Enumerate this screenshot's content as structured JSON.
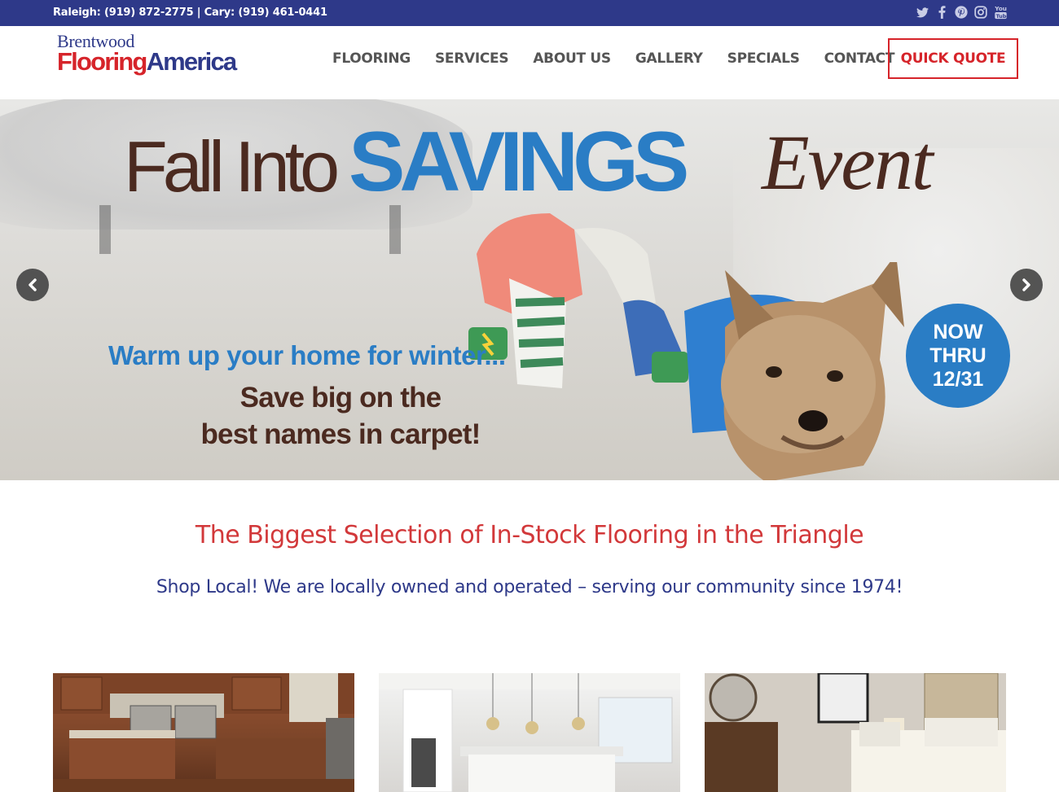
{
  "topbar": {
    "phones": "Raleigh: (919) 872-2775 | Cary: (919) 461-0441",
    "social_icons": [
      "twitter-icon",
      "facebook-icon",
      "pinterest-icon",
      "instagram-icon",
      "youtube-icon"
    ]
  },
  "logo": {
    "line1": "Brentwood",
    "line2_part1": "Flooring",
    "line2_part2": "America"
  },
  "nav": {
    "items": [
      "FLOORING",
      "SERVICES",
      "ABOUT US",
      "GALLERY",
      "SPECIALS",
      "CONTACT"
    ],
    "cta": "QUICK QUOTE"
  },
  "hero": {
    "title_part1": "Fall Into",
    "title_part2": "SAVINGS",
    "title_part3": "Event",
    "tagline1": "Warm up your home for winter...",
    "tagline2": "Save big on the",
    "tagline3": "best names in carpet!",
    "badge_line1": "NOW",
    "badge_line2": "THRU",
    "badge_line3": "12/31",
    "prev_glyph": "‹",
    "next_glyph": "›"
  },
  "content": {
    "headline": "The Biggest Selection of In-Stock Flooring in the Triangle",
    "subline": "Shop Local! We are locally owned and operated – serving our community since 1974!"
  },
  "colors": {
    "brand_blue": "#2e3989",
    "brand_red": "#d6242a",
    "hero_blue": "#2a7dc5",
    "hero_brown": "#4b2a20"
  }
}
